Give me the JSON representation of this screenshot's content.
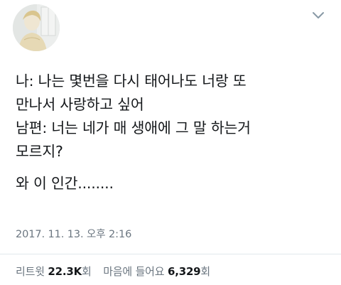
{
  "author": {
    "avatar_icon": "profile-photo-avatar"
  },
  "tweet": {
    "lines": [
      "나: 나는 몇번을 다시 태어나도 너랑 또",
      "만나서 사랑하고 싶어",
      "남편: 너는 네가 매 생애에 그 말 하는거",
      "모르지?",
      "와 이 인간........"
    ],
    "timestamp": "2017. 11. 13. 오후 2:16"
  },
  "stats": {
    "retweets_label": "리트윗",
    "retweets_count": "22.3K",
    "retweets_unit": "회",
    "likes_label": "마음에 들어요",
    "likes_count": "6,329",
    "likes_unit": "회"
  },
  "menu": {
    "icon": "chevron-down-icon"
  }
}
